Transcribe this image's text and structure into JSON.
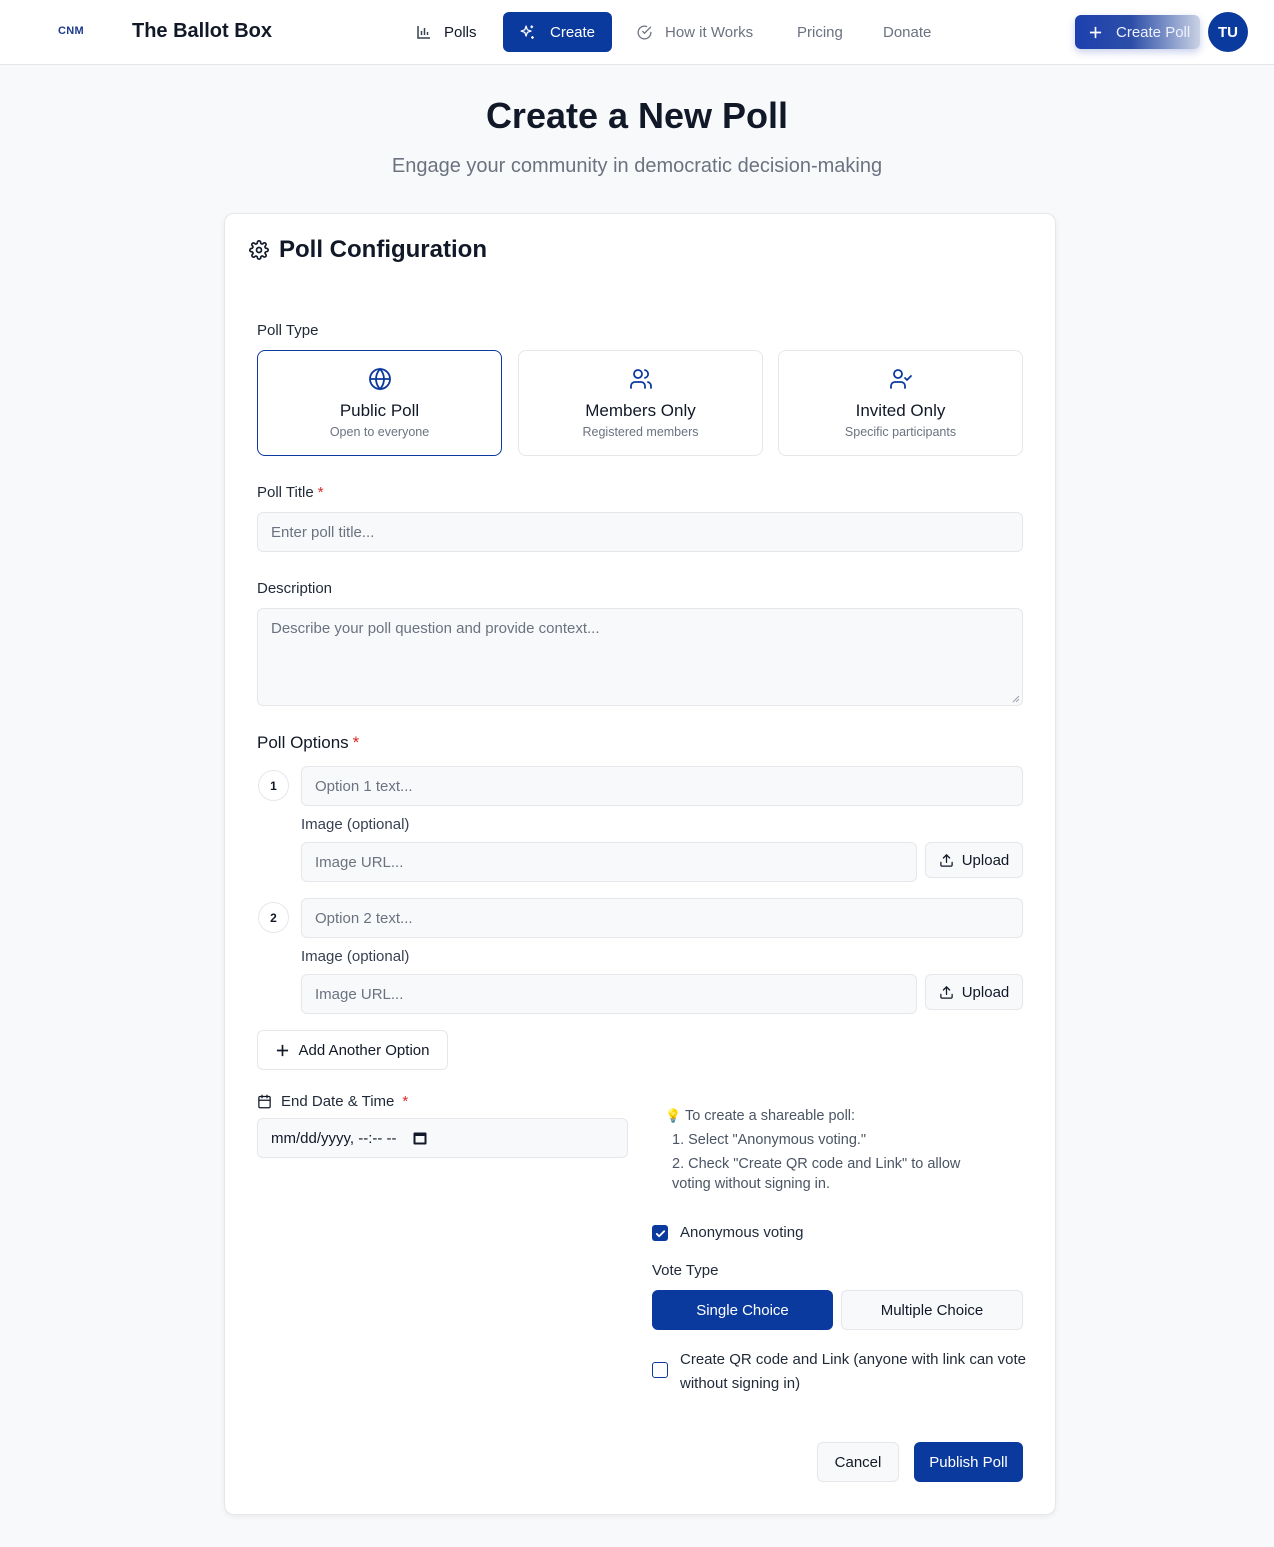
{
  "nav": {
    "logo": "CNM",
    "brand": "The Ballot Box",
    "links": [
      {
        "label": "Polls",
        "icon": "bar-chart-icon"
      },
      {
        "label": "Create",
        "icon": "sparkles-icon",
        "active": true
      },
      {
        "label": "How it Works",
        "icon": "check-circle-icon"
      },
      {
        "label": "Pricing"
      },
      {
        "label": "Donate"
      }
    ],
    "create_poll_label": "Create Poll",
    "avatar_initials": "TU"
  },
  "header": {
    "title": "Create a New Poll",
    "subtitle": "Engage your community in democratic decision-making"
  },
  "form": {
    "card_title": "Poll Configuration",
    "poll_type": {
      "label": "Poll Type",
      "options": [
        {
          "name": "Public Poll",
          "desc": "Open to everyone",
          "icon": "globe-icon",
          "selected": true
        },
        {
          "name": "Members Only",
          "desc": "Registered members",
          "icon": "users-icon",
          "selected": false
        },
        {
          "name": "Invited Only",
          "desc": "Specific participants",
          "icon": "user-check-icon",
          "selected": false
        }
      ]
    },
    "title_field": {
      "label": "Poll Title",
      "required_mark": "*",
      "placeholder": "Enter poll title..."
    },
    "description_field": {
      "label": "Description",
      "placeholder": "Describe your poll question and provide context..."
    },
    "options": {
      "label": "Poll Options",
      "required_mark": "*",
      "items": [
        {
          "number": "1",
          "placeholder": "Option 1 text...",
          "image_label": "Image (optional)",
          "image_placeholder": "Image URL...",
          "upload_label": "Upload"
        },
        {
          "number": "2",
          "placeholder": "Option 2 text...",
          "image_label": "Image (optional)",
          "image_placeholder": "Image URL...",
          "upload_label": "Upload"
        }
      ],
      "add_label": "Add Another Option"
    },
    "end_date": {
      "label": "End Date & Time",
      "required_mark": "*",
      "value": "mm/dd/yyyy, --:-- --"
    },
    "tips": {
      "emoji": "💡",
      "heading": "To create a shareable poll:",
      "line1": "1. Select \"Anonymous voting.\"",
      "line2a": "2. Check \"Create QR code and Link\" to allow",
      "line2b": "voting without signing in."
    },
    "anonymous_voting": {
      "label": "Anonymous voting",
      "checked": true
    },
    "vote_type": {
      "label": "Vote Type",
      "options": [
        "Single Choice",
        "Multiple Choice"
      ],
      "selected": "Single Choice"
    },
    "qr_link": {
      "label_line1": "Create QR code and Link (anyone with link can vote",
      "label_line2": "without signing in)",
      "checked": false
    },
    "actions": {
      "cancel": "Cancel",
      "publish": "Publish Poll"
    }
  },
  "colors": {
    "primary": "#0b3a9e",
    "required": "#dc2626",
    "muted": "#6b7280",
    "border": "#e5e7eb"
  }
}
